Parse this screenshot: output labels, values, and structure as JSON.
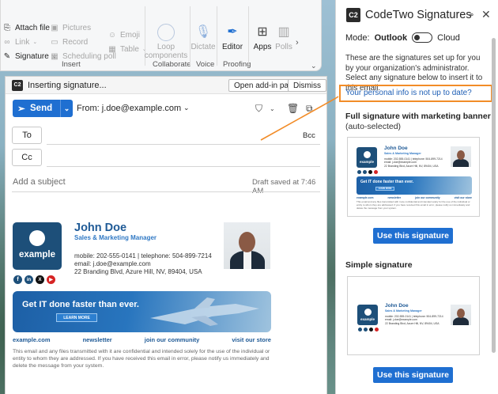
{
  "ribbon": {
    "col1": [
      "Attach file",
      "Link",
      "Signature"
    ],
    "col2": [
      "Pictures",
      "Record",
      "Scheduling poll"
    ],
    "col3": [
      "Emoji",
      "Table"
    ],
    "insert_label": "Insert",
    "loop_label": "Loop components",
    "collaborate_label": "Collaborate",
    "dictate_label": "Dictate",
    "voice_label": "Voice",
    "editor_label": "Editor",
    "proofing_label": "Proofing",
    "apps_label": "Apps",
    "polls_label": "Polls"
  },
  "compose": {
    "info_text": "Inserting signature...",
    "open_pane_label": "Open add-in pane",
    "dismiss_label": "Dismiss",
    "send_label": "Send",
    "from_text": "From: j.doe@example.com",
    "to_label": "To",
    "cc_label": "Cc",
    "bcc_label": "Bcc",
    "subject_placeholder": "Add a subject",
    "draft_status": "Draft saved at 7:46 AM"
  },
  "signature": {
    "logo_text": "example",
    "name": "John Doe",
    "role": "Sales & Marketing Manager",
    "line1": "mobile: 202-555-0141  |  telephone: 504-899-7214",
    "line2": "email: j.doe@example.com",
    "line3": "22 Branding Blvd, Azure Hill, NV, 89404, USA",
    "social": [
      "f",
      "in",
      "X",
      "▶"
    ],
    "banner_text": "Get IT done faster than ever.",
    "banner_button": "LEARN MORE",
    "links": [
      "example.com",
      "newsletter",
      "join our community",
      "visit our store"
    ],
    "disclaimer": "This email and any files transmitted with it are confidential and intended solely for the use of the individual or entity to whom they are addressed. If you have received this email in error, please notify us immediately and delete the message from your system."
  },
  "pane": {
    "title": "CodeTwo Signatures",
    "mode_label": "Mode:",
    "mode_outlook": "Outlook",
    "mode_cloud": "Cloud",
    "description": "These are the signatures set up for you by your organization's administrator. Select any signature below to insert it to this email.",
    "info_link": "Your personal info is not up to date?",
    "section1_title": "Full signature with marketing banner",
    "section1_sub": "(auto-selected)",
    "section2_title": "Simple signature",
    "use_button": "Use this signature"
  },
  "colors": {
    "accent": "#1f6fd1",
    "highlight": "#f28c28",
    "brand_dark": "#1d4f79",
    "link": "#1f5fb5"
  }
}
